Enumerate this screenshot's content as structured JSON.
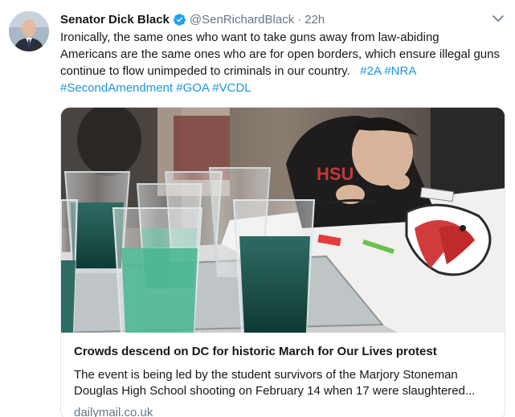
{
  "tweet": {
    "author_name": "Senator Dick Black",
    "handle": "@SenRichardBlack",
    "separator": "·",
    "time": "22h",
    "text_line_1": "Ironically, the same ones who want to take guns away from law-abiding",
    "text_line_2": "Americans are the same ones who are for open borders, which ensure illegal guns",
    "text_line_3": "continue to flow unimpeded to criminals in our country.",
    "hashtags_line_3": [
      "#2A",
      "#NRA"
    ],
    "hashtags_line_4": [
      "#SecondAmendment",
      "#GOA",
      "#VCDL"
    ]
  },
  "card": {
    "title": "Crowds descend on DC for historic March for Our Lives protest",
    "description": "The event is being led by the student survivors of the Marjory Stoneman Douglas High School shooting on February 14 when 17 were slaughtered...",
    "domain": "dailymail.co.uk",
    "image_text": "HSU"
  },
  "colors": {
    "link": "#1b95e0",
    "secondary": "#657786",
    "verified": "#1da1f2",
    "border": "#e1e8ed"
  },
  "icons": {
    "verified": "verified-badge-icon",
    "caret": "chevron-down-icon"
  }
}
